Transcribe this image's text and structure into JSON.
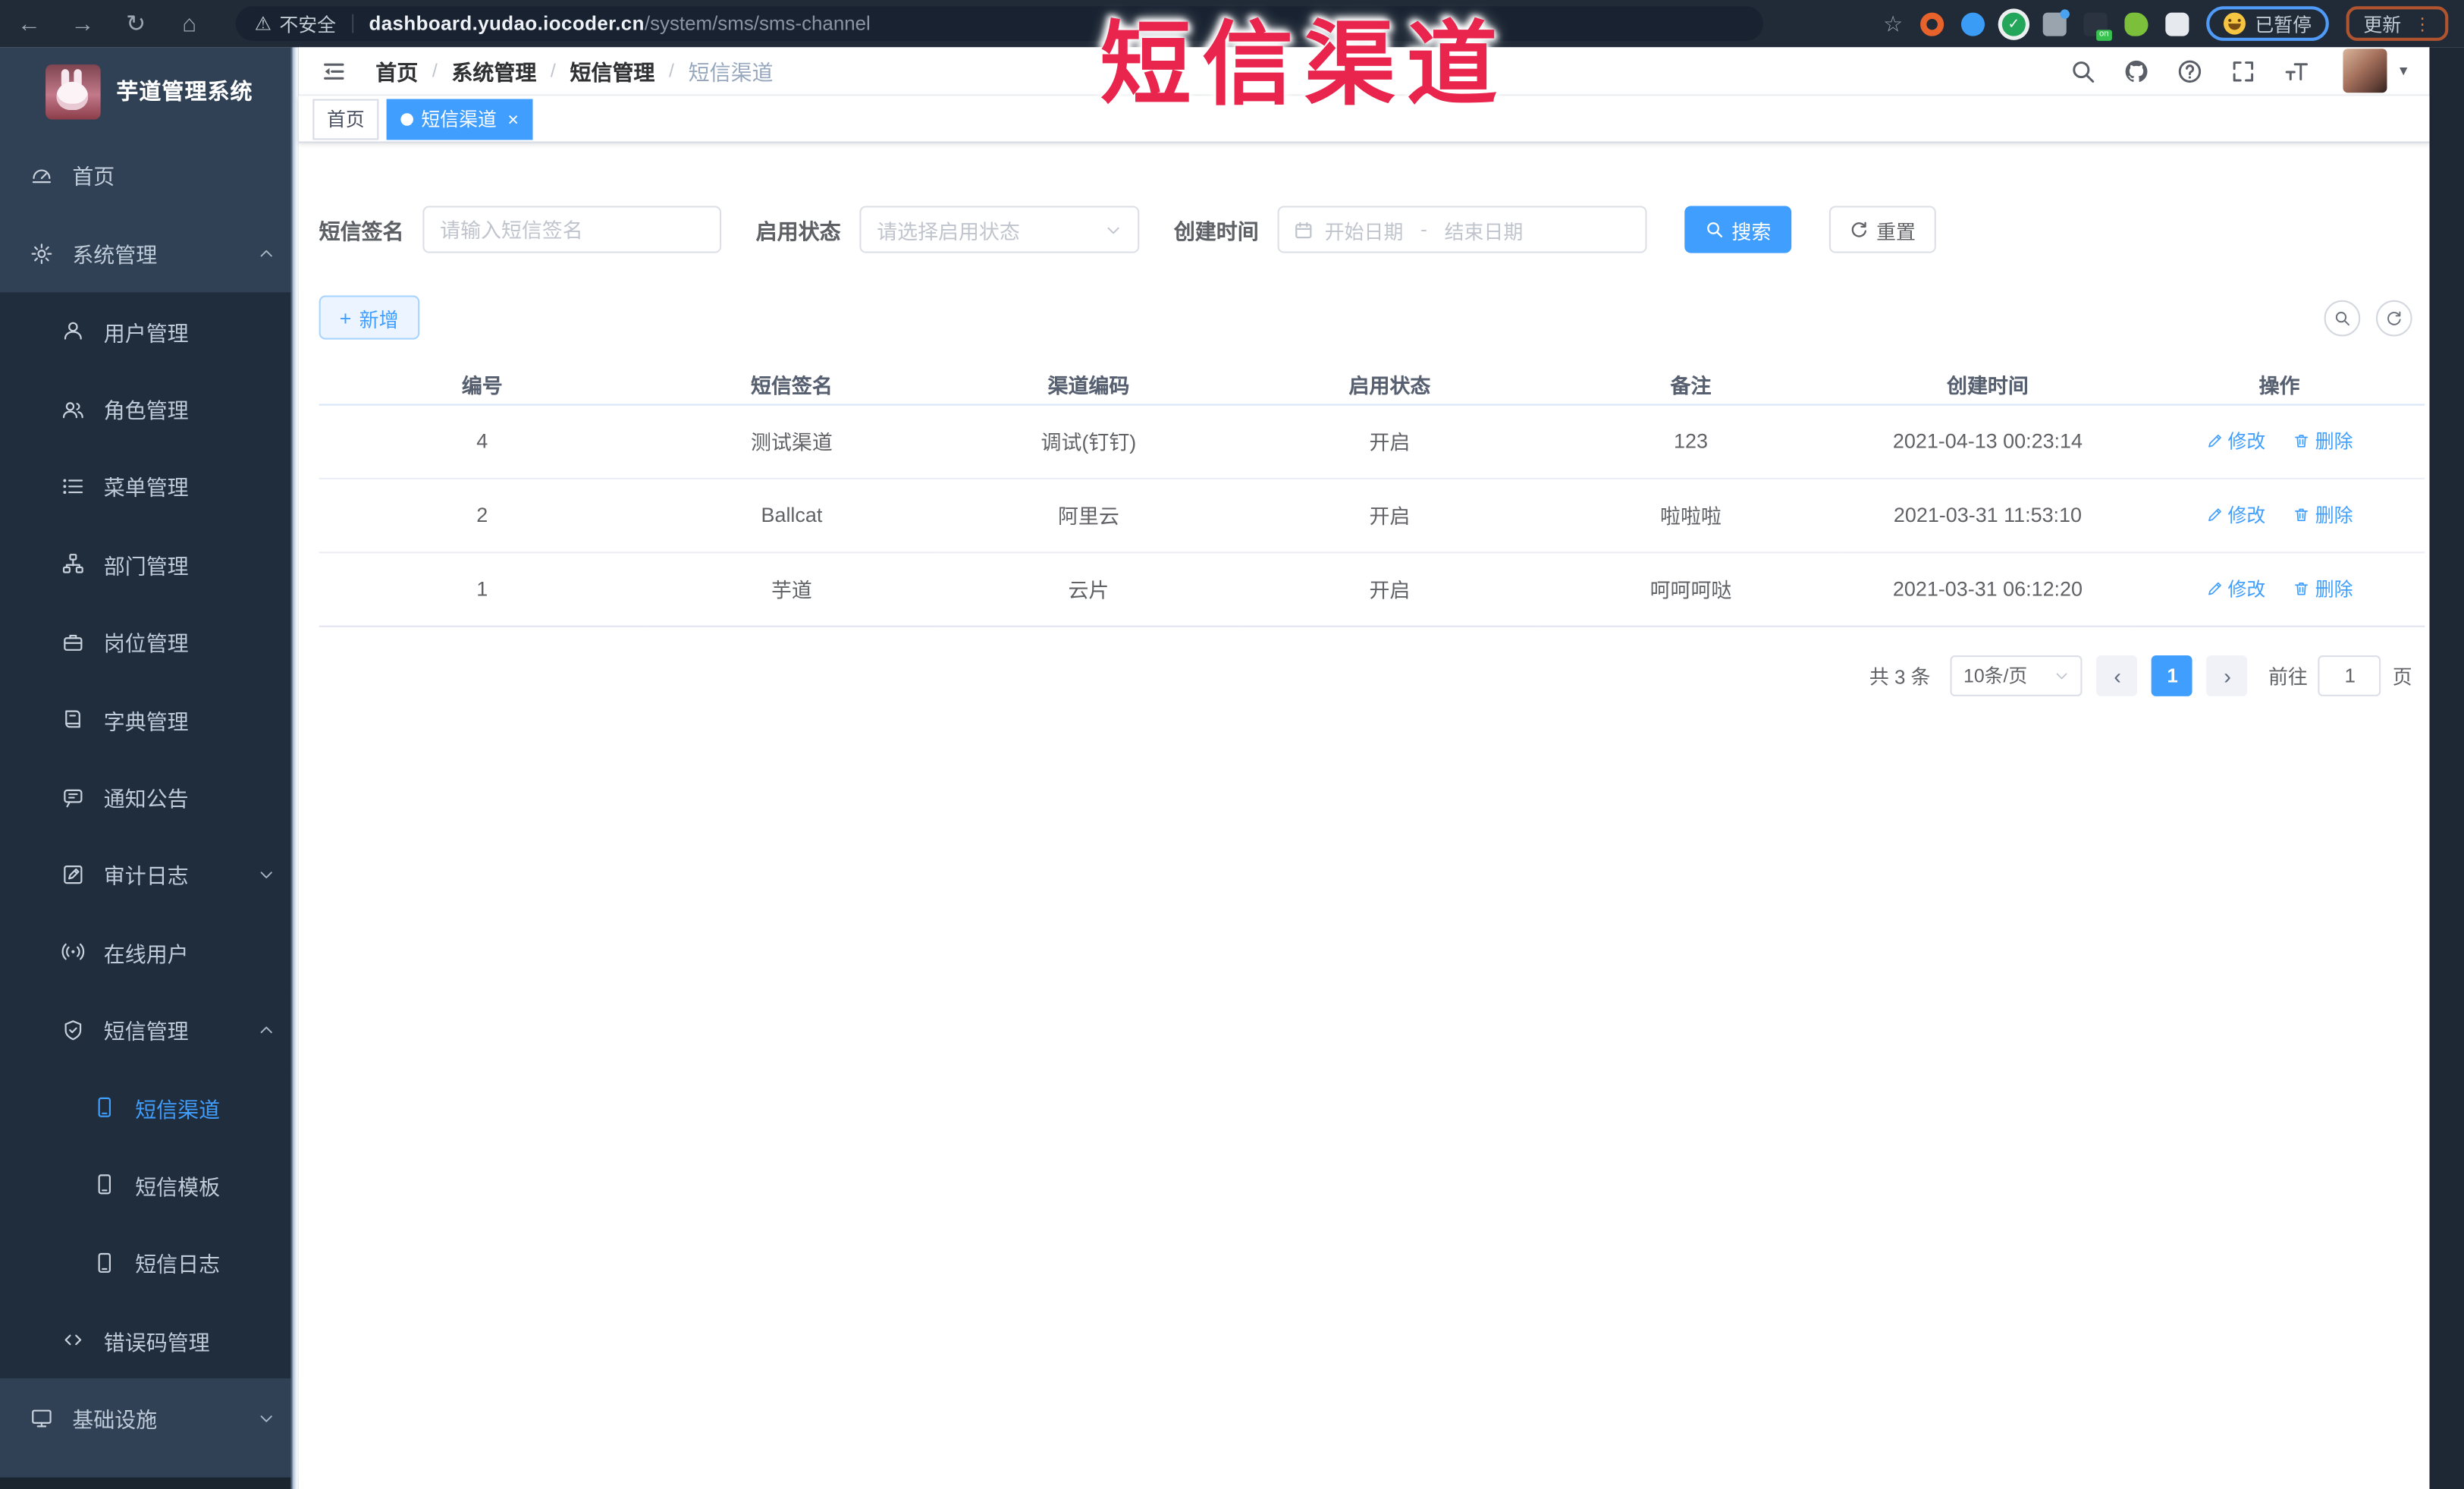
{
  "browser": {
    "security_label": "不安全",
    "url_host": "dashboard.yudao.iocoder.cn",
    "url_path": "/system/sms/sms-channel",
    "paused_badge": "已暂停",
    "update_button": "更新",
    "extensions": [
      {
        "name": "orange-ring-extension-icon",
        "color": "#e8622c"
      },
      {
        "name": "blue-drop-extension-icon",
        "color": "#3b9cf5"
      },
      {
        "name": "green-check-extension-icon",
        "color": "#23a55a"
      },
      {
        "name": "gray-grid-extension-icon",
        "color": "#9aa4ae"
      },
      {
        "name": "dark-on-badge-extension-icon",
        "color": "#2b3340"
      },
      {
        "name": "green-sprout-extension-icon",
        "color": "#7bbf3a"
      },
      {
        "name": "white-puzzle-extension-icon",
        "color": "#e6eaee"
      }
    ]
  },
  "overlay_title": "短信渠道",
  "sidebar": {
    "app_title": "芋道管理系统",
    "menu": [
      {
        "label": "首页",
        "icon": "dashboard",
        "level": 1
      },
      {
        "label": "系统管理",
        "icon": "gear",
        "level": 1,
        "arrow": "up"
      },
      {
        "label": "用户管理",
        "icon": "user",
        "level": 2
      },
      {
        "label": "角色管理",
        "icon": "users",
        "level": 2
      },
      {
        "label": "菜单管理",
        "icon": "list",
        "level": 2
      },
      {
        "label": "部门管理",
        "icon": "tree",
        "level": 2
      },
      {
        "label": "岗位管理",
        "icon": "post",
        "level": 2
      },
      {
        "label": "字典管理",
        "icon": "dict",
        "level": 2
      },
      {
        "label": "通知公告",
        "icon": "notice",
        "level": 2
      },
      {
        "label": "审计日志",
        "icon": "audit",
        "level": 2,
        "arrow": "down"
      },
      {
        "label": "在线用户",
        "icon": "online",
        "level": 2
      },
      {
        "label": "短信管理",
        "icon": "sms",
        "level": 2,
        "arrow": "up"
      },
      {
        "label": "短信渠道",
        "icon": "phone",
        "level": 3,
        "active": true
      },
      {
        "label": "短信模板",
        "icon": "phone",
        "level": 3
      },
      {
        "label": "短信日志",
        "icon": "phone",
        "level": 3
      },
      {
        "label": "错误码管理",
        "icon": "code",
        "level": 2
      },
      {
        "label": "基础设施",
        "icon": "monitor",
        "level": 1,
        "arrow": "down"
      }
    ]
  },
  "navbar": {
    "breadcrumb": [
      "首页",
      "系统管理",
      "短信管理",
      "短信渠道"
    ]
  },
  "tags": [
    {
      "label": "首页",
      "active": false,
      "closable": false
    },
    {
      "label": "短信渠道",
      "active": true,
      "closable": true
    }
  ],
  "filters": {
    "sign_label": "短信签名",
    "sign_placeholder": "请输入短信签名",
    "status_label": "启用状态",
    "status_placeholder": "请选择启用状态",
    "time_label": "创建时间",
    "start_placeholder": "开始日期",
    "range_separator": "-",
    "end_placeholder": "结束日期",
    "search_button": "搜索",
    "reset_button": "重置"
  },
  "toolbar": {
    "add_button": "新增"
  },
  "table": {
    "columns": [
      "编号",
      "短信签名",
      "渠道编码",
      "启用状态",
      "备注",
      "创建时间",
      "操作"
    ],
    "edit_action": "修改",
    "delete_action": "删除",
    "rows": [
      {
        "id": "4",
        "sign": "测试渠道",
        "code": "调试(钉钉)",
        "status": "开启",
        "remark": "123",
        "created": "2021-04-13 00:23:14"
      },
      {
        "id": "2",
        "sign": "Ballcat",
        "code": "阿里云",
        "status": "开启",
        "remark": "啦啦啦",
        "created": "2021-03-31 11:53:10"
      },
      {
        "id": "1",
        "sign": "芋道",
        "code": "云片",
        "status": "开启",
        "remark": "呵呵呵哒",
        "created": "2021-03-31 06:12:20"
      }
    ]
  },
  "pagination": {
    "total_text": "共 3 条",
    "page_size": "10条/页",
    "current_page": "1",
    "prev_glyph": "‹",
    "next_glyph": "›",
    "goto_label": "前往",
    "goto_value": "1",
    "page_unit": "页"
  },
  "colors": {
    "accent": "#409eff",
    "sidebar_bg": "#304156",
    "submenu_bg": "#1f2d3d",
    "chrome_bg": "#212b38",
    "overlay_red": "#e9244d",
    "active_tag": "#409eff"
  }
}
